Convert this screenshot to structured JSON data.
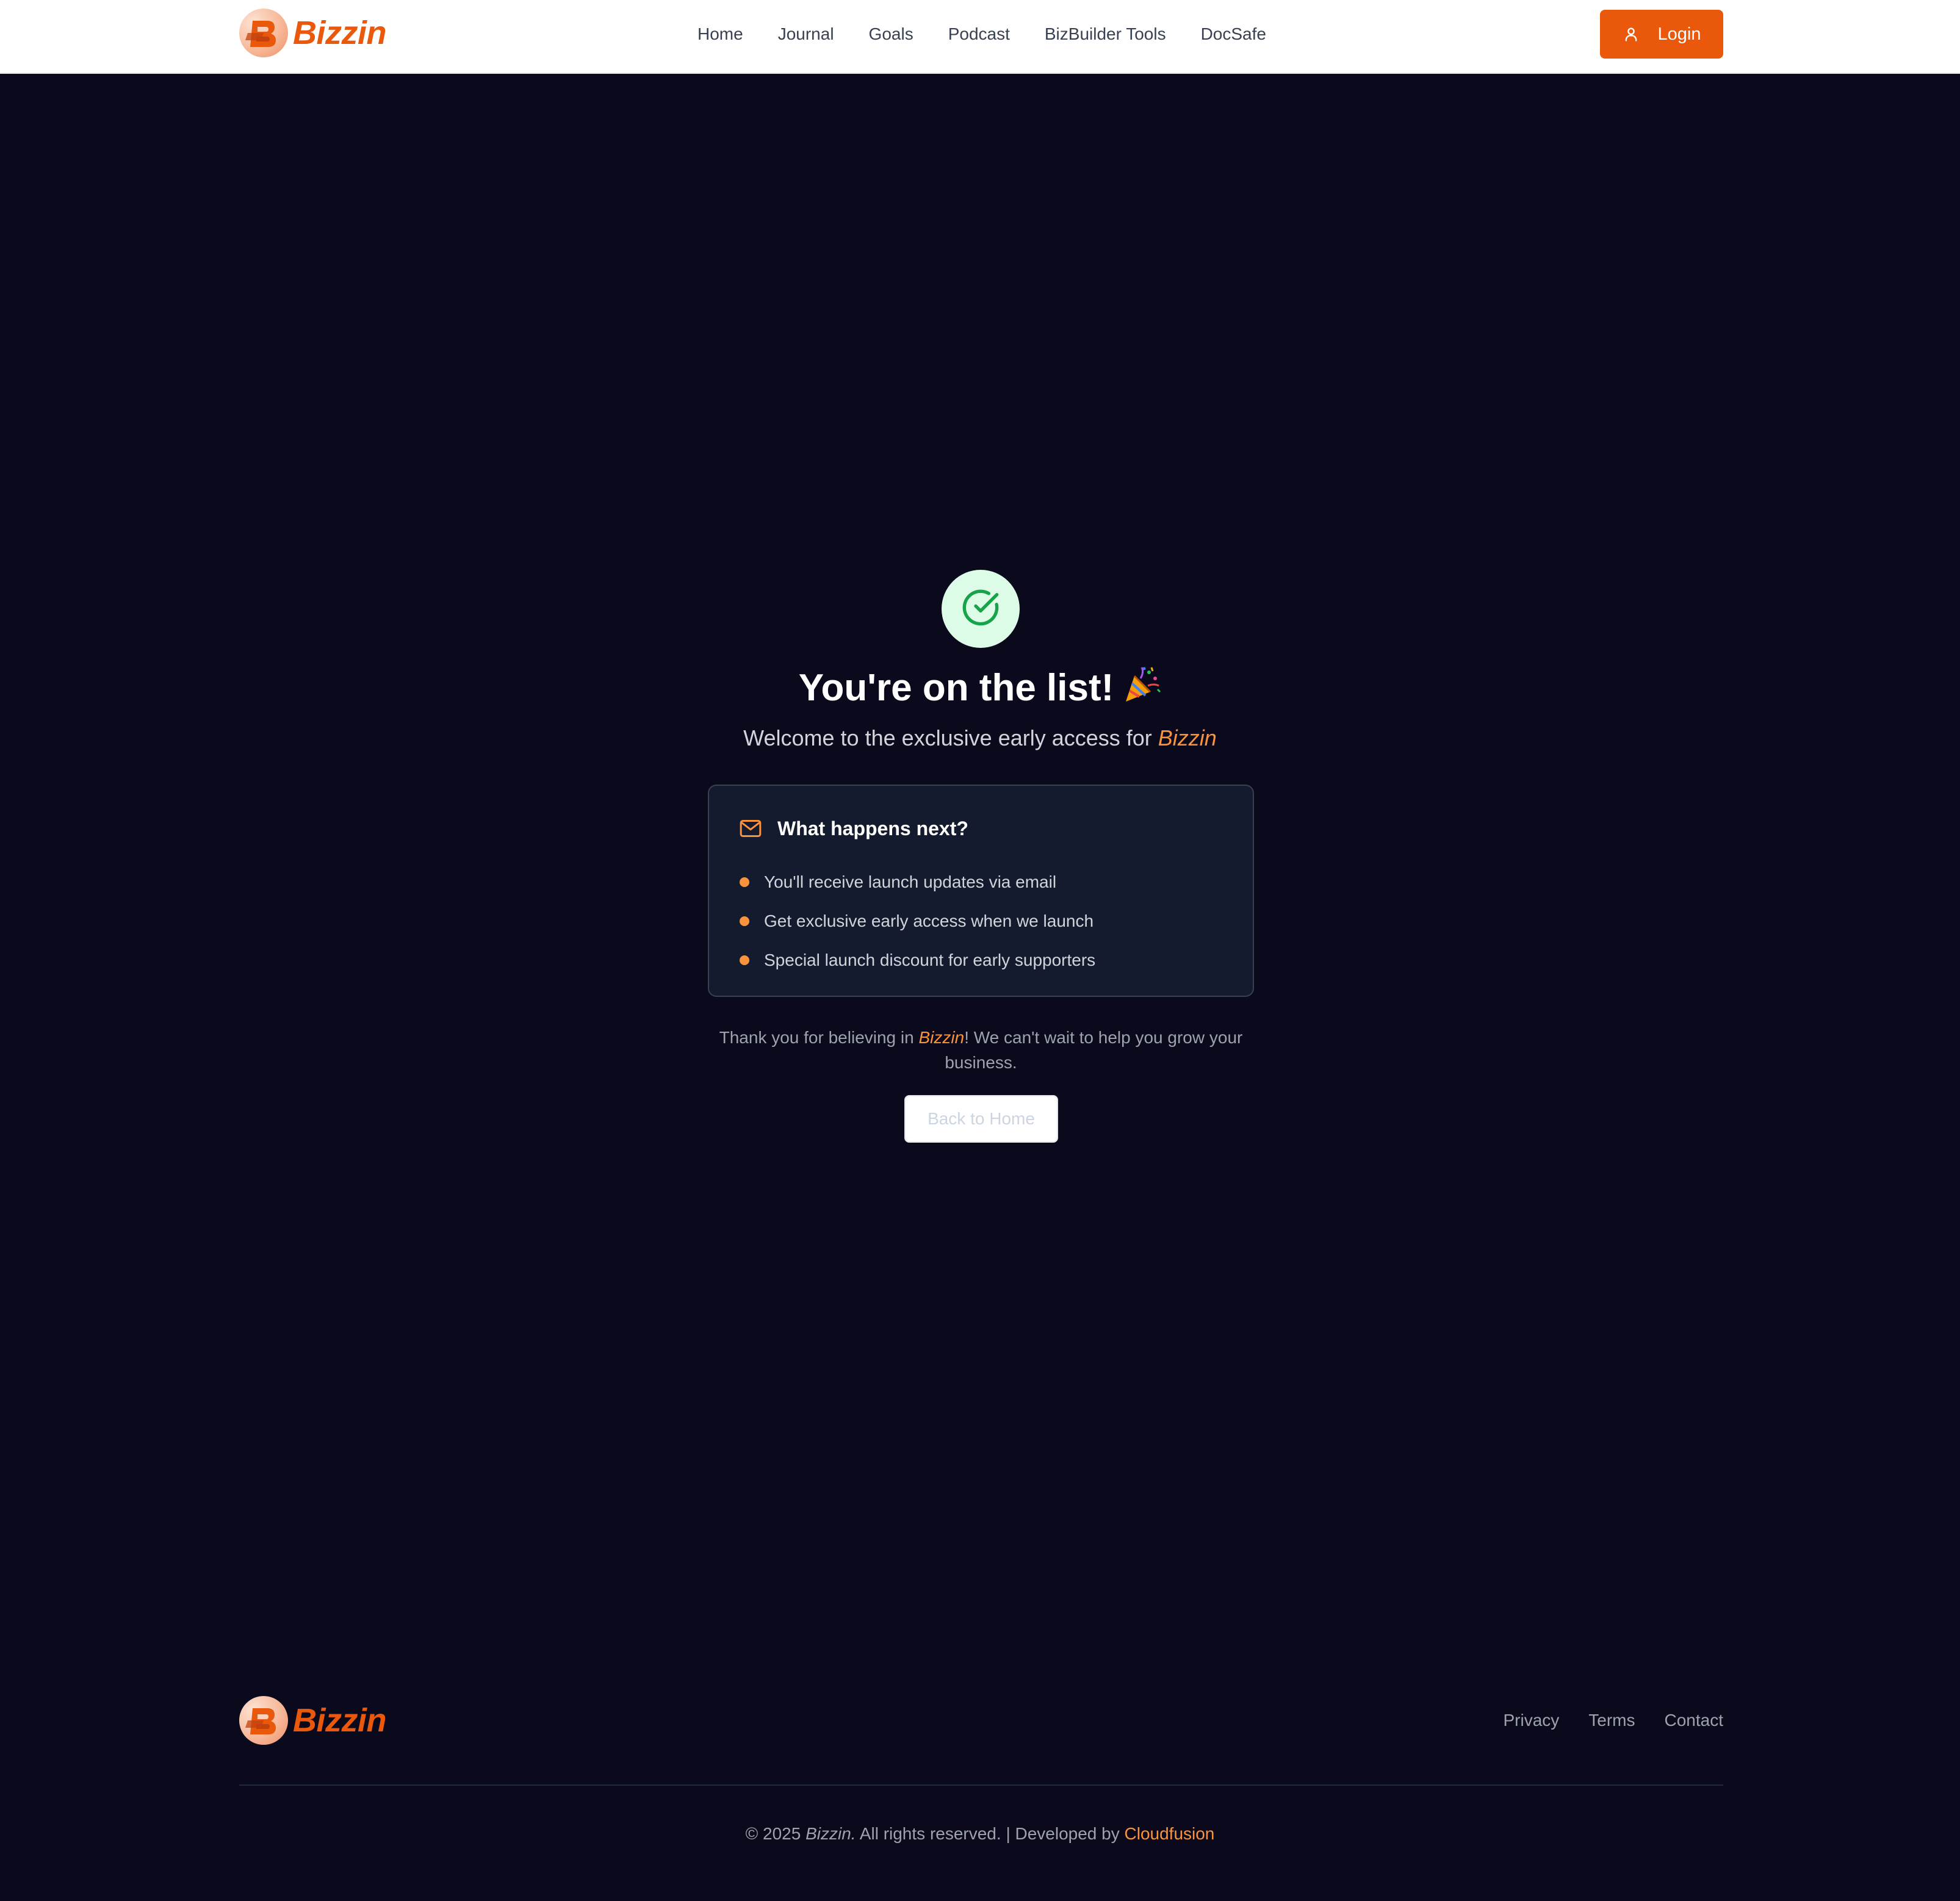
{
  "header": {
    "brand_name": "Bizzin",
    "nav": [
      {
        "label": "Home"
      },
      {
        "label": "Journal"
      },
      {
        "label": "Goals"
      },
      {
        "label": "Podcast"
      },
      {
        "label": "BizBuilder Tools"
      },
      {
        "label": "DocSafe"
      }
    ],
    "login_label": "Login"
  },
  "main": {
    "headline": "You're on the list!",
    "subline_prefix": "Welcome to the exclusive early access for ",
    "subline_brand": "Bizzin",
    "card": {
      "title": "What happens next?",
      "items": [
        "You'll receive launch updates via email",
        "Get exclusive early access when we launch",
        "Special launch discount for early supporters"
      ]
    },
    "thanks_prefix": "Thank you for believing in ",
    "thanks_brand": "Bizzin",
    "thanks_suffix": "! We can't wait to help you grow your business.",
    "back_label": "Back to Home"
  },
  "footer": {
    "brand_name": "Bizzin",
    "links": [
      {
        "label": "Privacy"
      },
      {
        "label": "Terms"
      },
      {
        "label": "Contact"
      }
    ],
    "copyright_prefix": "© 2025 ",
    "copyright_brand": "Bizzin.",
    "copyright_rest": " All rights reserved. | Developed by ",
    "credit": "Cloudfusion"
  },
  "icons": {
    "logo": "bizzin-logo-icon",
    "user": "user-icon",
    "success": "check-circle-icon",
    "party": "party-popper-icon",
    "mail": "mail-icon"
  },
  "colors": {
    "accent": "#ea580c",
    "accent_light": "#fb923c",
    "background": "#0b0a1c",
    "card_bg": "#151b2e",
    "success_bg": "#dcfce7",
    "success_fg": "#16a34a"
  }
}
